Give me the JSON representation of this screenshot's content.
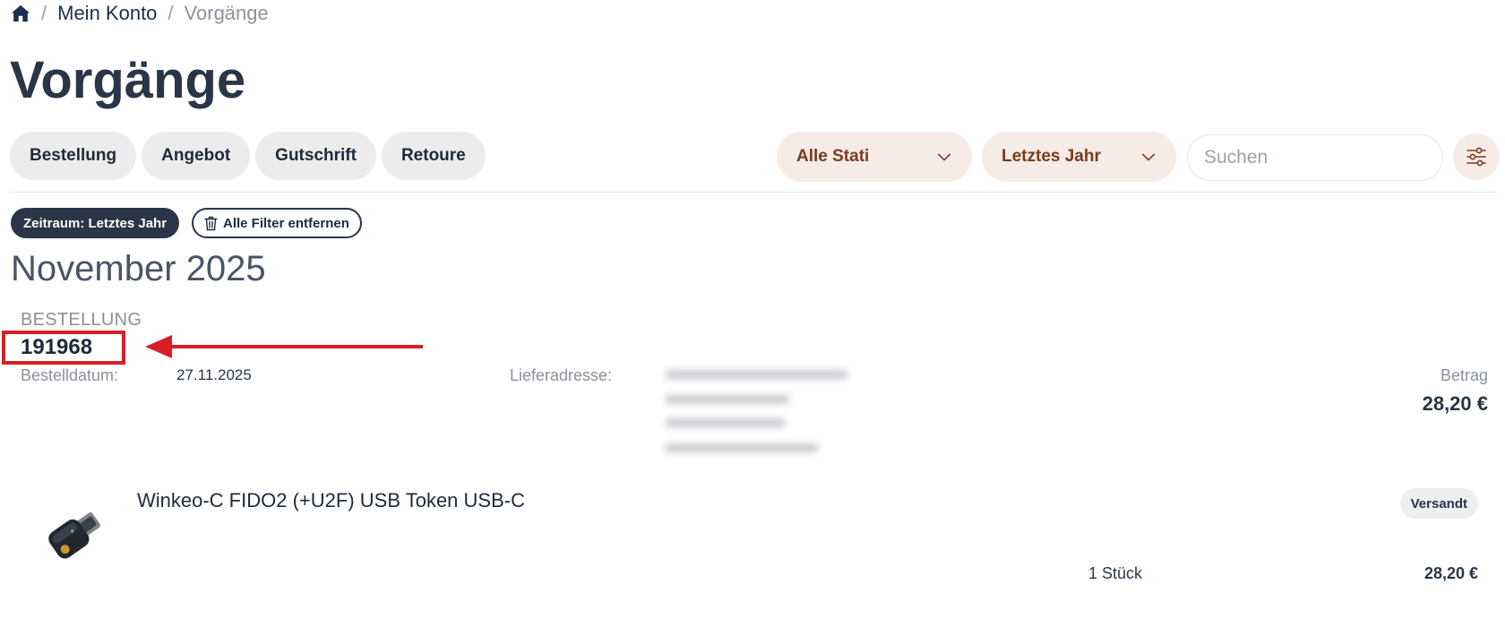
{
  "breadcrumb": {
    "home_icon": "home-icon",
    "separator": "/",
    "items": [
      {
        "label": "Mein Konto"
      },
      {
        "label": "Vorgänge"
      }
    ]
  },
  "page": {
    "title": "Vorgänge"
  },
  "type_filters": [
    {
      "label": "Bestellung"
    },
    {
      "label": "Angebot"
    },
    {
      "label": "Gutschrift"
    },
    {
      "label": "Retoure"
    }
  ],
  "filters": {
    "status_select": {
      "value": "Alle Stati",
      "icon": "chevron-down-icon"
    },
    "period_select": {
      "value": "Letztes Jahr",
      "icon": "chevron-down-icon"
    },
    "search": {
      "placeholder": "Suchen",
      "value": ""
    },
    "settings_icon": "sliders-icon",
    "accent_color": "#f6ebe6",
    "accent_text_color": "#7a3b1e"
  },
  "active_filters": {
    "period_chip": "Zeitraum: Letztes Jahr",
    "clear_all": "Alle Filter entfernen",
    "clear_icon": "trash-icon"
  },
  "month_heading": "November 2025",
  "order": {
    "type": "BESTELLUNG",
    "number": "191968",
    "date_label": "Bestelldatum:",
    "date_value": "27.11.2025",
    "address_label": "Lieferadresse:",
    "amount_label": "Betrag",
    "amount_value": "28,20 €",
    "highlight_color": "#d81f26"
  },
  "items": [
    {
      "name": "Winkeo-C FIDO2 (+U2F) USB Token USB-C",
      "status": "Versandt",
      "quantity": "1 Stück",
      "price": "28,20 €"
    }
  ]
}
